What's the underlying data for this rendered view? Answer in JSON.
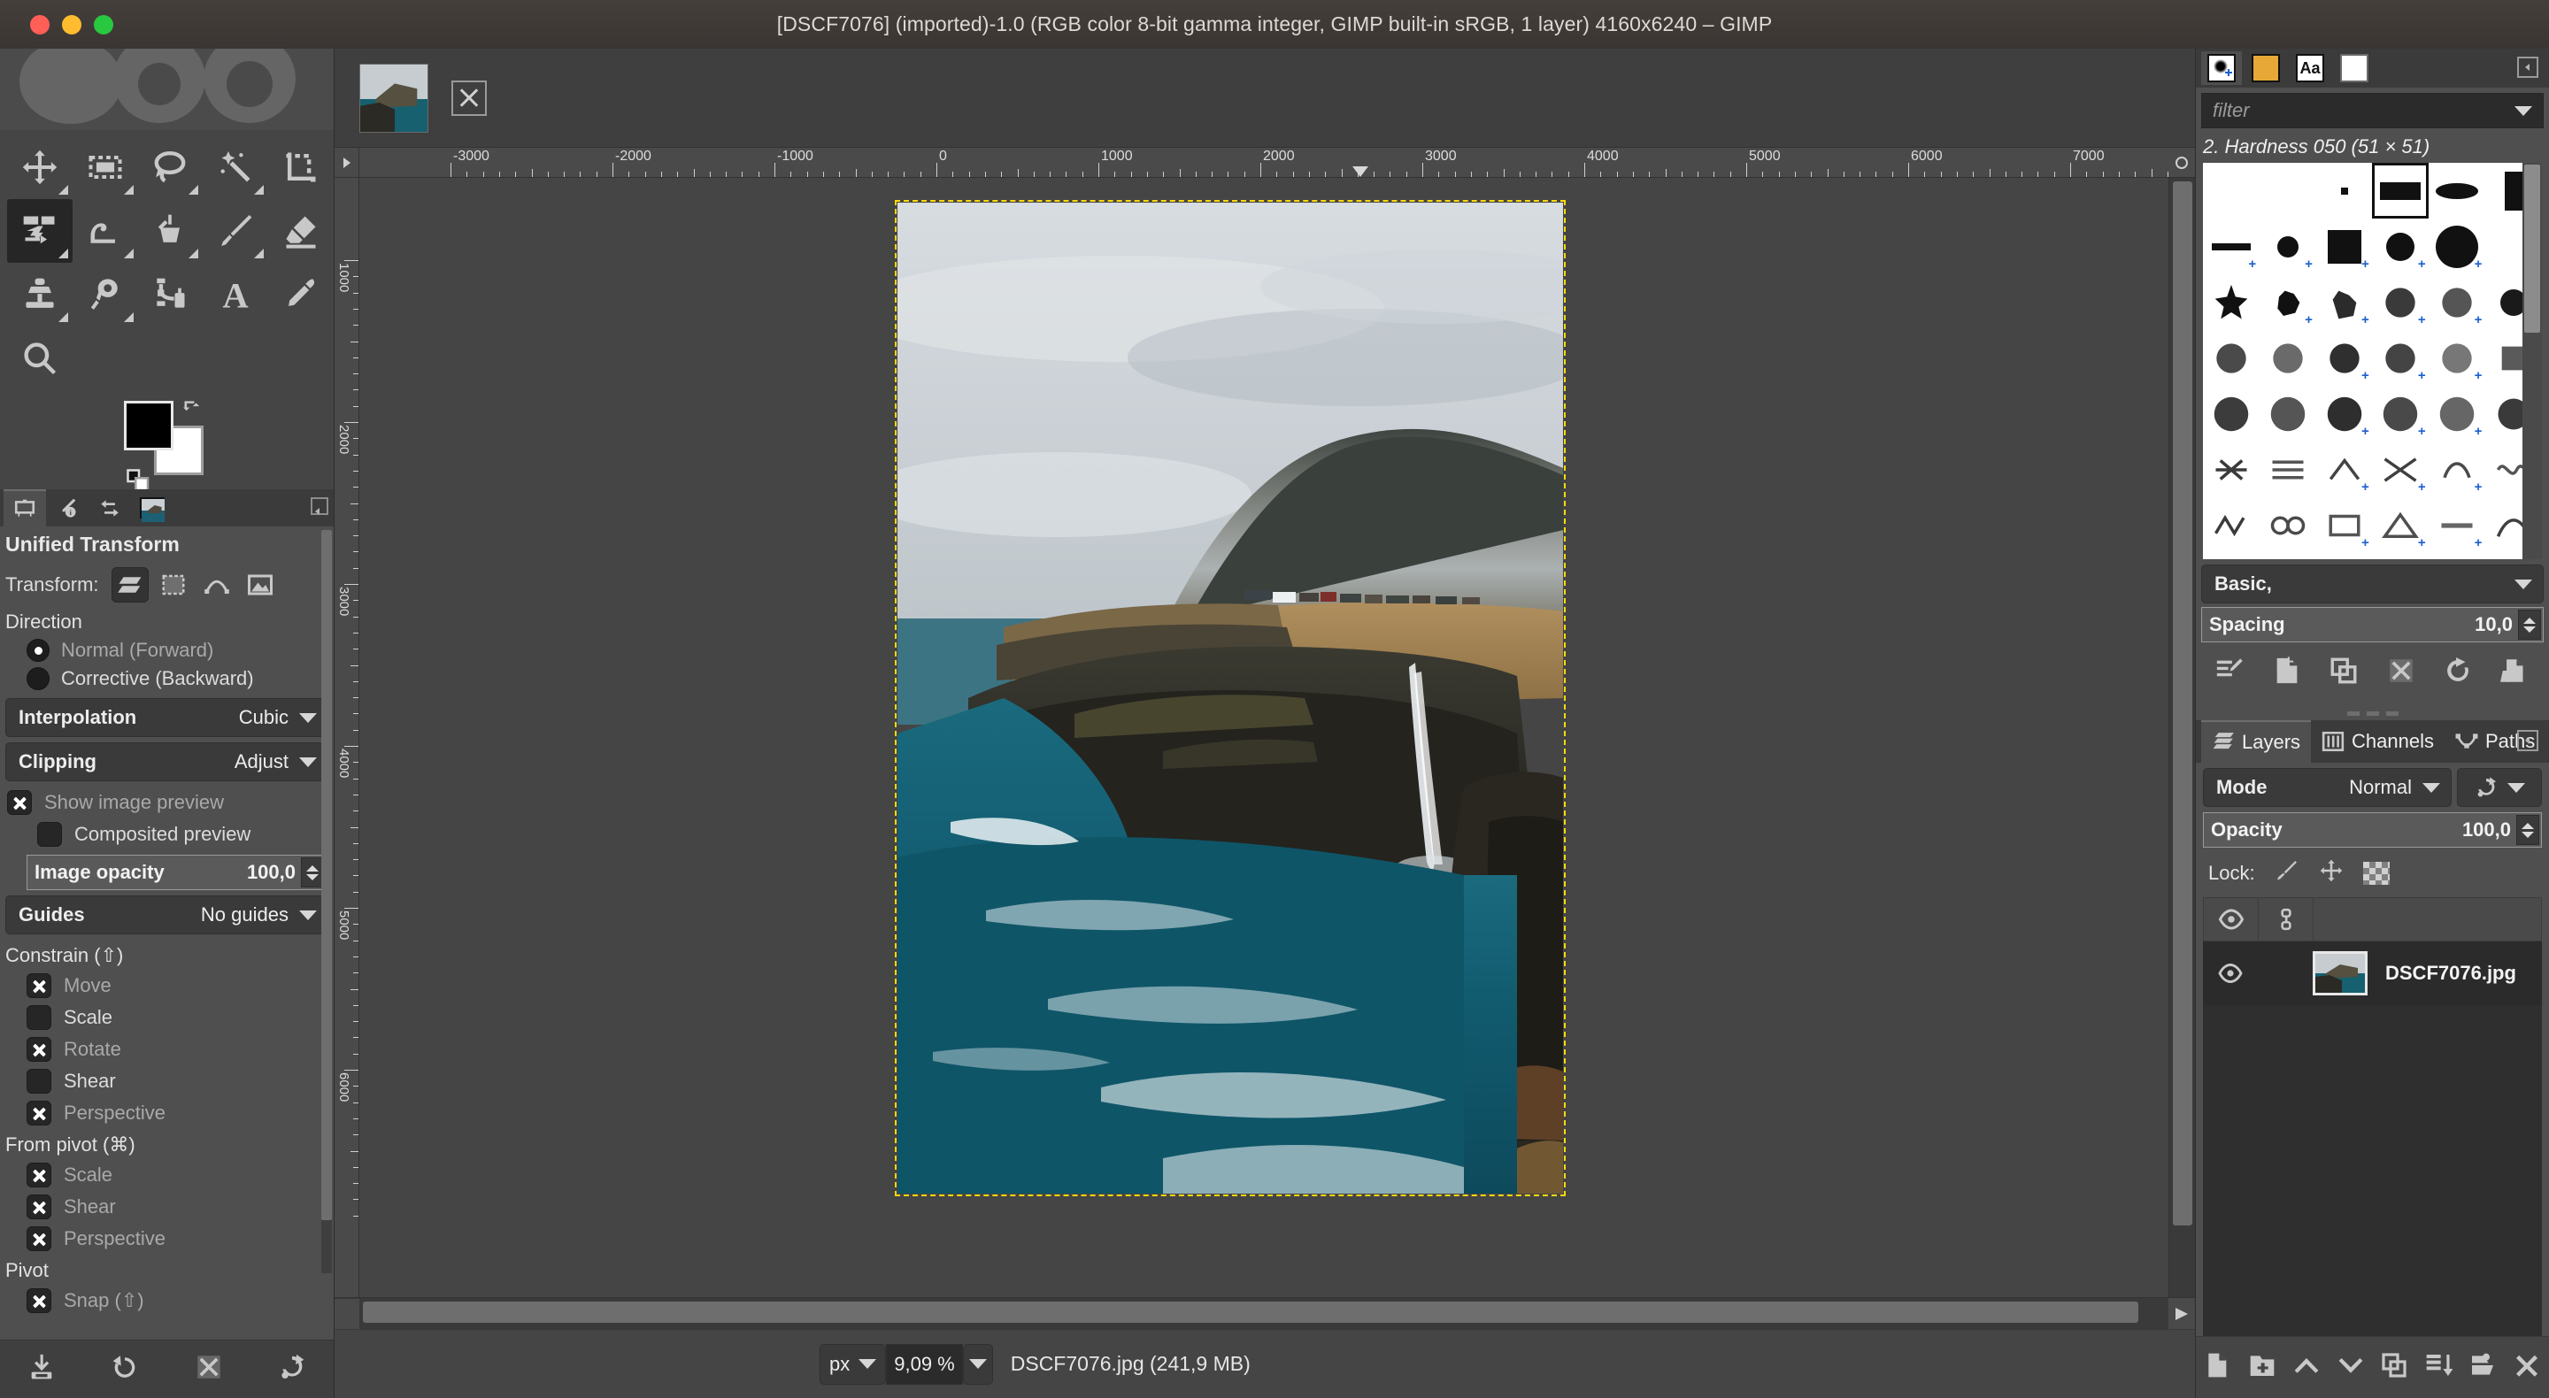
{
  "window": {
    "title": "[DSCF7076] (imported)-1.0 (RGB color 8-bit gamma integer, GIMP built-in sRGB, 1 layer) 4160x6240 – GIMP",
    "app_name": "GIMP",
    "traffic_lights": [
      "close",
      "minimize",
      "zoom"
    ]
  },
  "toolbox": {
    "tools": [
      {
        "name": "move-tool",
        "icon": "move-icon",
        "selected": false
      },
      {
        "name": "rectangle-select-tool",
        "icon": "rectangle-select-icon",
        "selected": false
      },
      {
        "name": "free-select-tool",
        "icon": "lasso-icon",
        "selected": false
      },
      {
        "name": "fuzzy-select-tool",
        "icon": "magic-wand-icon",
        "selected": false
      },
      {
        "name": "crop-tool",
        "icon": "crop-icon",
        "selected": false
      },
      {
        "name": "unified-transform-tool",
        "icon": "unified-transform-icon",
        "selected": true
      },
      {
        "name": "warp-transform-tool",
        "icon": "warp-icon",
        "selected": false
      },
      {
        "name": "bucket-fill-tool",
        "icon": "bucket-fill-icon",
        "selected": false
      },
      {
        "name": "paintbrush-tool",
        "icon": "paintbrush-icon",
        "selected": false
      },
      {
        "name": "eraser-tool",
        "icon": "eraser-icon",
        "selected": false
      },
      {
        "name": "clone-tool",
        "icon": "clone-stamp-icon",
        "selected": false
      },
      {
        "name": "smudge-tool",
        "icon": "smudge-icon",
        "selected": false
      },
      {
        "name": "path-tool",
        "icon": "path-icon",
        "selected": false
      },
      {
        "name": "text-tool",
        "icon": "text-a-icon",
        "selected": false
      },
      {
        "name": "color-picker-tool",
        "icon": "eyedropper-icon",
        "selected": false
      },
      {
        "name": "zoom-tool",
        "icon": "magnifier-icon",
        "selected": false
      }
    ],
    "foreground_color": "#000000",
    "background_color": "#ffffff"
  },
  "tool_options": {
    "tabs": [
      "tool-options",
      "device-status",
      "undo-history",
      "images"
    ],
    "active_tab": "tool-options",
    "title": "Unified Transform",
    "transform_label": "Transform:",
    "transform_targets": [
      "layer",
      "selection",
      "path",
      "image"
    ],
    "transform_active_index": 0,
    "direction": {
      "header": "Direction",
      "options": [
        {
          "label": "Normal (Forward)",
          "selected": true
        },
        {
          "label": "Corrective (Backward)",
          "selected": false
        }
      ]
    },
    "interpolation": {
      "label": "Interpolation",
      "value": "Cubic"
    },
    "clipping": {
      "label": "Clipping",
      "value": "Adjust"
    },
    "show_image_preview": {
      "label": "Show image preview",
      "checked": true
    },
    "composited_preview": {
      "label": "Composited preview",
      "checked": false
    },
    "image_opacity": {
      "label": "Image opacity",
      "value": "100,0"
    },
    "guides": {
      "label": "Guides",
      "value": "No guides"
    },
    "constrain": {
      "header": "Constrain (⇧)",
      "items": [
        {
          "label": "Move",
          "checked": true
        },
        {
          "label": "Scale",
          "checked": false
        },
        {
          "label": "Rotate",
          "checked": true
        },
        {
          "label": "Shear",
          "checked": false
        },
        {
          "label": "Perspective",
          "checked": true
        }
      ]
    },
    "from_pivot": {
      "header": "From pivot  (⌘)",
      "items": [
        {
          "label": "Scale",
          "checked": true
        },
        {
          "label": "Shear",
          "checked": true
        },
        {
          "label": "Perspective",
          "checked": true
        }
      ]
    },
    "pivot": {
      "header": "Pivot",
      "items": [
        {
          "label": "Snap (⇧)",
          "checked": true
        }
      ]
    },
    "footer_buttons": [
      "save-tool-preset",
      "restore-tool-preset",
      "delete-tool-preset",
      "reset-tool-options"
    ]
  },
  "canvas": {
    "tab_thumbnail_title": "DSCF7076",
    "close_tab_label": "close",
    "h_ruler_labels": [
      "-3000",
      "-2000",
      "-1000",
      "0",
      "1000",
      "2000",
      "3000",
      "4000",
      "5000",
      "6000",
      "7000"
    ],
    "v_ruler_labels": [
      "1000",
      "2000",
      "3000",
      "4000",
      "5000",
      "6000"
    ],
    "unit": "px",
    "zoom": "9,09 %",
    "status_text": "DSCF7076.jpg (241,9 MB)"
  },
  "brushes": {
    "tabs": [
      "brushes",
      "patterns",
      "fonts",
      "documents"
    ],
    "active_tab": "brushes",
    "filter_placeholder": "filter",
    "selected_brush": "2. Hardness 050 (51 × 51)",
    "tag_filter": "Basic,",
    "spacing_label": "Spacing",
    "spacing_value": "10,0",
    "buttons": [
      "edit-brush",
      "new-brush",
      "duplicate-brush",
      "delete-brush",
      "refresh-brushes",
      "open-brush-as-image"
    ]
  },
  "layers": {
    "tabs": [
      {
        "label": "Layers",
        "icon": "layers-icon",
        "active": true
      },
      {
        "label": "Channels",
        "icon": "channels-icon",
        "active": false
      },
      {
        "label": "Paths",
        "icon": "paths-icon",
        "active": false
      }
    ],
    "mode_label": "Mode",
    "mode_value": "Normal",
    "opacity_label": "Opacity",
    "opacity_value": "100,0",
    "lock_label": "Lock:",
    "lock_items": [
      "lock-pixels",
      "lock-position",
      "lock-alpha"
    ],
    "column_headers": [
      "visibility",
      "link"
    ],
    "rows": [
      {
        "name": "DSCF7076.jpg",
        "visible": true,
        "linked": false,
        "selected": true
      }
    ],
    "footer_buttons": [
      "new-layer",
      "new-layer-group",
      "raise-layer",
      "lower-layer",
      "duplicate-layer",
      "merge-down",
      "anchor-layer",
      "delete-layer"
    ]
  },
  "colors": {
    "accent_yellow": "#ffd90a",
    "panel_bg": "#454545",
    "panel_bg_light": "#4f4f4f",
    "titlebar_bg": "#3b3633",
    "text": "#d3d3d3"
  }
}
